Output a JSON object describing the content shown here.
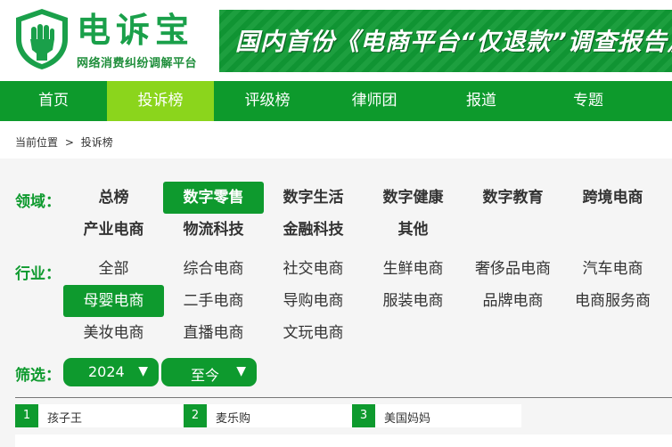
{
  "header": {
    "logo_title": "电诉宝",
    "logo_subtitle": "网络消费纠纷调解平台",
    "banner_text": "国内首份《电商平台“仅退款”调查报告》"
  },
  "nav": {
    "items": [
      {
        "label": "首页"
      },
      {
        "label": "投诉榜"
      },
      {
        "label": "评级榜"
      },
      {
        "label": "律师团"
      },
      {
        "label": "报道"
      },
      {
        "label": "专题"
      }
    ],
    "active_index": 1
  },
  "breadcrumb": {
    "prefix": "当前位置",
    "separator": ">",
    "current": "投诉榜"
  },
  "filters": {
    "domain_label": "领域：",
    "domains": [
      "总榜",
      "数字零售",
      "数字生活",
      "数字健康",
      "数字教育",
      "跨境电商",
      "产业电商",
      "物流科技",
      "金融科技",
      "其他"
    ],
    "domain_active": "数字零售",
    "industry_label": "行业：",
    "industries": [
      "全部",
      "综合电商",
      "社交电商",
      "生鲜电商",
      "奢侈品电商",
      "汽车电商",
      "母婴电商",
      "二手电商",
      "导购电商",
      "服装电商",
      "品牌电商",
      "电商服务商",
      "美妆电商",
      "直播电商",
      "文玩电商"
    ],
    "industry_active": "母婴电商",
    "screen_label": "筛选：",
    "year_value": "2024",
    "until_value": "至今",
    "caret_glyph": "▼"
  },
  "ranking": [
    {
      "rank": "1",
      "name": "孩子王"
    },
    {
      "rank": "2",
      "name": "麦乐购"
    },
    {
      "rank": "3",
      "name": "美国妈妈"
    }
  ],
  "colors": {
    "brand_green": "#0e9a2e",
    "nav_active": "#8bd51c",
    "filter_bg": "#f5f5f5"
  }
}
